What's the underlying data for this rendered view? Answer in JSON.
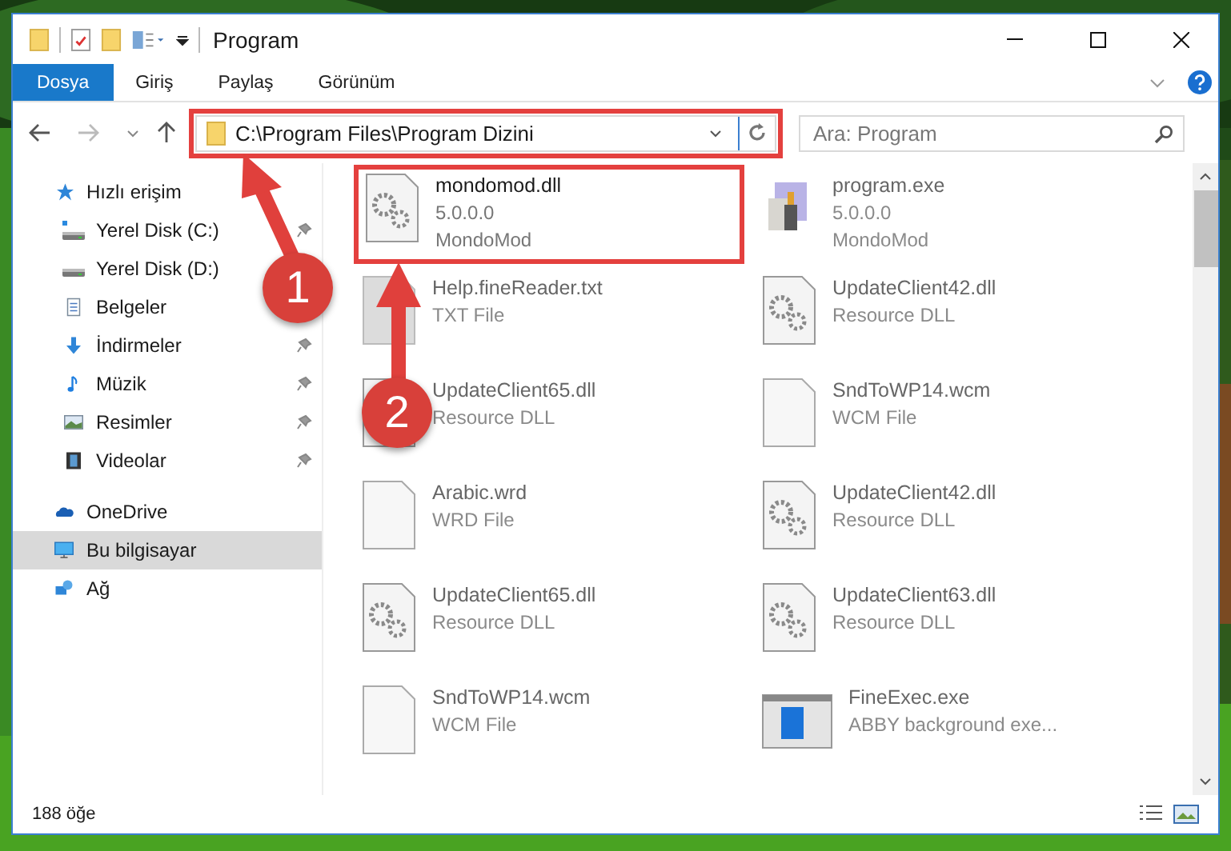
{
  "window": {
    "title": "Program"
  },
  "ribbon_tabs": [
    {
      "label": "Dosya",
      "selected": true
    },
    {
      "label": "Giriş",
      "selected": false
    },
    {
      "label": "Paylaş",
      "selected": false
    },
    {
      "label": "Görünüm",
      "selected": false
    }
  ],
  "address": {
    "value": "C:\\Program Files\\Program Dizini",
    "highlighted": true
  },
  "search": {
    "placeholder": "Ara: Program"
  },
  "sidebar": {
    "items": [
      {
        "label": "Hızlı erişim",
        "kind": "star",
        "selected": false,
        "children": [
          {
            "label": "Yerel Disk (C:)",
            "kind": "drivec",
            "pinned": true,
            "selected": false
          },
          {
            "label": "Yerel Disk (D:)",
            "kind": "drive",
            "selected": false
          },
          {
            "label": "Belgeler",
            "kind": "docs",
            "selected": false
          },
          {
            "label": "İndirmeler",
            "kind": "download",
            "pinned": true,
            "selected": false
          },
          {
            "label": "Müzik",
            "kind": "music",
            "pinned": true,
            "selected": false
          },
          {
            "label": "Resimler",
            "kind": "pictures",
            "pinned": true,
            "selected": false
          },
          {
            "label": "Videolar",
            "kind": "video",
            "pinned": true,
            "selected": false
          }
        ]
      },
      {
        "label": "OneDrive",
        "kind": "cloud",
        "selected": false
      },
      {
        "label": "Bu bilgisayar",
        "kind": "pc",
        "selected": true
      },
      {
        "label": "Ağ",
        "kind": "network",
        "selected": false
      }
    ]
  },
  "files": [
    {
      "name": "mondomod.dll",
      "lines": [
        "5.0.0.0",
        "MondoMod"
      ],
      "kind": "dll",
      "highlighted": true
    },
    {
      "name": "program.exe",
      "lines": [
        "5.0.0.0",
        "MondoMod"
      ],
      "kind": "exe",
      "highlighted": false
    },
    {
      "name": "Help.fineReader.txt",
      "lines": [
        "TXT File"
      ],
      "kind": "txt",
      "highlighted": false
    },
    {
      "name": "UpdateClient42.dll",
      "lines": [
        "Resource DLL"
      ],
      "kind": "dll",
      "highlighted": false
    },
    {
      "name": "UpdateClient65.dll",
      "lines": [
        "Resource DLL"
      ],
      "kind": "dll",
      "highlighted": false
    },
    {
      "name": "SndToWP14.wcm",
      "lines": [
        "WCM File"
      ],
      "kind": "file",
      "highlighted": false
    },
    {
      "name": "Arabic.wrd",
      "lines": [
        "WRD File"
      ],
      "kind": "file",
      "highlighted": false
    },
    {
      "name": "UpdateClient42.dll",
      "lines": [
        "Resource DLL"
      ],
      "kind": "dll",
      "highlighted": false
    },
    {
      "name": "UpdateClient65.dll",
      "lines": [
        "Resource DLL"
      ],
      "kind": "dll",
      "highlighted": false
    },
    {
      "name": "UpdateClient63.dll",
      "lines": [
        "Resource DLL"
      ],
      "kind": "dll",
      "highlighted": false
    },
    {
      "name": "SndToWP14.wcm",
      "lines": [
        "WCM File"
      ],
      "kind": "file",
      "highlighted": false
    },
    {
      "name": "FineExec.exe",
      "lines": [
        "ABBY background exe..."
      ],
      "kind": "app",
      "highlighted": false
    }
  ],
  "status_bar": {
    "count": "188 öğe"
  },
  "annotations": [
    {
      "number": "1"
    },
    {
      "number": "2"
    }
  ]
}
